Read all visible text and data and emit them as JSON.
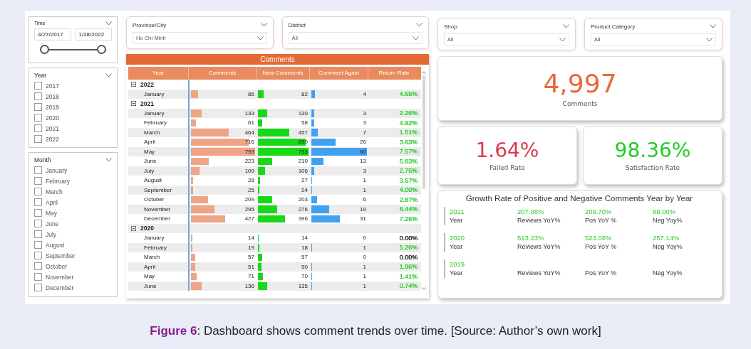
{
  "time_slicer": {
    "title": "Time",
    "from": "4/27/2017",
    "to": "1/28/2022",
    "range": {
      "start": {
        "level": 0
      },
      "end": {
        "level": 1
      }
    }
  },
  "year_slicer": {
    "title": "Year",
    "options": [
      {
        "label": "2017",
        "checked": false
      },
      {
        "label": "2018",
        "checked": false
      },
      {
        "label": "2019",
        "checked": false
      },
      {
        "label": "2020",
        "checked": false
      },
      {
        "label": "2021",
        "checked": false
      },
      {
        "label": "2022",
        "checked": false
      }
    ]
  },
  "month_slicer": {
    "title": "Month",
    "options": [
      {
        "label": "January",
        "checked": false
      },
      {
        "label": "February",
        "checked": false
      },
      {
        "label": "March",
        "checked": false
      },
      {
        "label": "April",
        "checked": false
      },
      {
        "label": "May",
        "checked": false
      },
      {
        "label": "June",
        "checked": false
      },
      {
        "label": "July",
        "checked": false
      },
      {
        "label": "August",
        "checked": false
      },
      {
        "label": "September",
        "checked": false
      },
      {
        "label": "October",
        "checked": false
      },
      {
        "label": "November",
        "checked": false
      },
      {
        "label": "December",
        "checked": false
      }
    ]
  },
  "location_filters": [
    {
      "title": "Province/City",
      "value": "Hồ Chí Minh"
    },
    {
      "title": "District",
      "value": "All"
    }
  ],
  "product_filters": [
    {
      "title": "Shop",
      "value": "All"
    },
    {
      "title": "Product Category",
      "value": "All"
    }
  ],
  "comments_table": {
    "title": "Comments",
    "columns": [
      "Year",
      "Comments",
      "New Comments",
      "Comment Again",
      "Return Rate"
    ],
    "rows": [
      {
        "kind": "group",
        "label": "2022",
        "expanded": true
      },
      {
        "kind": "month",
        "label": "January",
        "comments": "86",
        "new_comments": "82",
        "comment_again": "4",
        "return_rate": "4.65%",
        "color": "#2ecc2e"
      },
      {
        "kind": "group",
        "label": "2021",
        "expanded": true
      },
      {
        "kind": "month",
        "label": "January",
        "comments": "133",
        "new_comments": "130",
        "comment_again": "3",
        "return_rate": "2.26%",
        "color": "#2ecc2e"
      },
      {
        "kind": "month",
        "label": "February",
        "comments": "61",
        "new_comments": "58",
        "comment_again": "3",
        "return_rate": "4.92%",
        "color": "#2ecc2e"
      },
      {
        "kind": "month",
        "label": "March",
        "comments": "464",
        "new_comments": "457",
        "comment_again": "7",
        "return_rate": "1.51%",
        "color": "#2ecc2e"
      },
      {
        "kind": "month",
        "label": "April",
        "comments": "716",
        "new_comments": "690",
        "comment_again": "26",
        "return_rate": "3.63%",
        "color": "#2ecc2e"
      },
      {
        "kind": "month",
        "label": "May",
        "comments": "793",
        "new_comments": "733",
        "comment_again": "60",
        "return_rate": "7.57%",
        "color": "#2ecc2e"
      },
      {
        "kind": "month",
        "label": "June",
        "comments": "223",
        "new_comments": "210",
        "comment_again": "13",
        "return_rate": "5.83%",
        "color": "#2ecc2e"
      },
      {
        "kind": "month",
        "label": "July",
        "comments": "109",
        "new_comments": "106",
        "comment_again": "3",
        "return_rate": "2.75%",
        "color": "#2ecc2e"
      },
      {
        "kind": "month",
        "label": "August",
        "comments": "28",
        "new_comments": "27",
        "comment_again": "1",
        "return_rate": "3.57%",
        "color": "#2ecc2e"
      },
      {
        "kind": "month",
        "label": "September",
        "comments": "25",
        "new_comments": "24",
        "comment_again": "1",
        "return_rate": "4.00%",
        "color": "#2ecc2e"
      },
      {
        "kind": "month",
        "label": "October",
        "comments": "209",
        "new_comments": "203",
        "comment_again": "6",
        "return_rate": "2.87%",
        "color": "#2ecc2e"
      },
      {
        "kind": "month",
        "label": "November",
        "comments": "295",
        "new_comments": "276",
        "comment_again": "19",
        "return_rate": "6.44%",
        "color": "#2ecc2e"
      },
      {
        "kind": "month",
        "label": "December",
        "comments": "427",
        "new_comments": "396",
        "comment_again": "31",
        "return_rate": "7.26%",
        "color": "#2ecc2e"
      },
      {
        "kind": "group",
        "label": "2020",
        "expanded": true
      },
      {
        "kind": "month",
        "label": "January",
        "comments": "14",
        "new_comments": "14",
        "comment_again": "0",
        "return_rate": "0.00%",
        "color": "#222222"
      },
      {
        "kind": "month",
        "label": "February",
        "comments": "19",
        "new_comments": "18",
        "comment_again": "1",
        "return_rate": "5.26%",
        "color": "#2ecc2e"
      },
      {
        "kind": "month",
        "label": "March",
        "comments": "57",
        "new_comments": "57",
        "comment_again": "0",
        "return_rate": "0.00%",
        "color": "#222222"
      },
      {
        "kind": "month",
        "label": "April",
        "comments": "51",
        "new_comments": "50",
        "comment_again": "1",
        "return_rate": "1.96%",
        "color": "#2ecc2e"
      },
      {
        "kind": "month",
        "label": "May",
        "comments": "71",
        "new_comments": "70",
        "comment_again": "1",
        "return_rate": "1.41%",
        "color": "#2ecc2e"
      },
      {
        "kind": "month",
        "label": "June",
        "comments": "136",
        "new_comments": "135",
        "comment_again": "1",
        "return_rate": "0.74%",
        "color": "#2ecc2e"
      }
    ]
  },
  "kpis": [
    {
      "value": "4,997",
      "label": "Comments",
      "color": "#e8693a"
    },
    {
      "value": "1.64%",
      "label": "Failed Rate",
      "color": "#d93a4e"
    },
    {
      "value": "98.36%",
      "label": "Satisfaction Rate",
      "color": "#22cc22"
    }
  ],
  "growth": {
    "title": "Growth Rate of Positive and Negative Comments Year by Year",
    "rows": [
      {
        "year": "2021",
        "year_label": "Year",
        "metrics": [
          {
            "value": "207.08%",
            "label": "Reviews YoY%"
          },
          {
            "value": "209.70%",
            "label": "Pos YoY %"
          },
          {
            "value": "88.00%",
            "label": "Neg Yoy%"
          }
        ]
      },
      {
        "year": "2020",
        "year_label": "Year",
        "metrics": [
          {
            "value": "513.23%",
            "label": "Reviews YoY%"
          },
          {
            "value": "523.08%",
            "label": "Pos YoY %"
          },
          {
            "value": "257.14%",
            "label": "Neg Yoy%"
          }
        ]
      },
      {
        "year": "2019",
        "year_label": "Year",
        "metrics": [
          {
            "label": "Reviews YoY%"
          },
          {
            "label": "Pos YoY %"
          },
          {
            "label": "Neg Yoy%"
          }
        ]
      }
    ]
  },
  "caption": "**Figure 6**: Dashboard shows comment trends over time. [Source: Author’s own work]"
}
